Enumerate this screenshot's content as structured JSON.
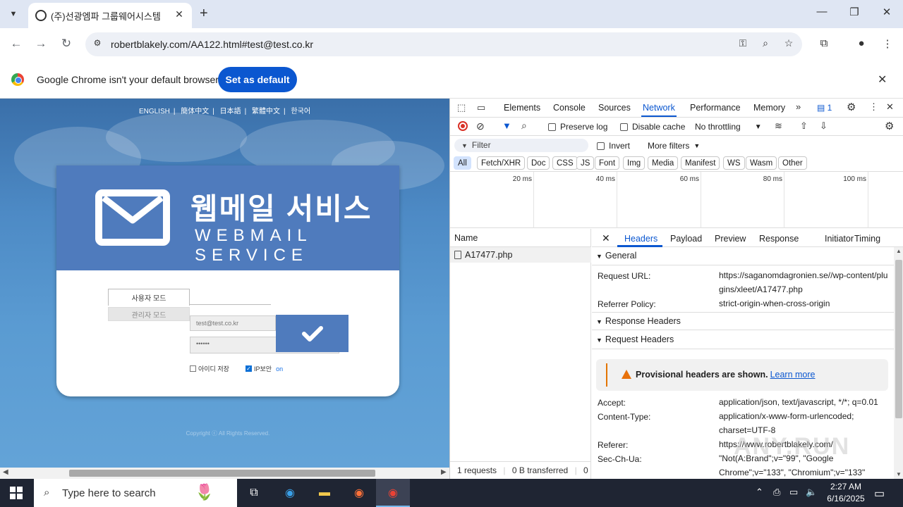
{
  "browser": {
    "tab_title": "(주)선광엠파 그룹웨어시스템",
    "tab_close": "✕",
    "new_tab": "+",
    "url": "robertblakely.com/AA122.html#test@test.co.kr",
    "infobar_message": "Google Chrome isn't your default browser",
    "set_default_label": "Set as default",
    "window_controls": {
      "minimize": "—",
      "restore": "❐",
      "close": "✕"
    }
  },
  "page": {
    "languages": [
      "ENGLISH",
      "簡体中文",
      "日本語",
      "繁體中文",
      "한국어"
    ],
    "title_korean": "웹메일 서비스",
    "title_english": "WEBMAIL SERVICE",
    "user_mode_tab": "사용자 모드",
    "admin_mode_tab": "관리자 모드",
    "email_value": "test@test.co.kr",
    "password_value": "••••••",
    "save_id_label": "아이디 저장",
    "ip_security_label": "IP보안",
    "ip_security_state": "on",
    "copyright": "Copyright ⓒ All Rights Reserved."
  },
  "devtools": {
    "tabs": [
      "Elements",
      "Console",
      "Sources",
      "Network",
      "Performance",
      "Memory"
    ],
    "active_tab": "Network",
    "issues_count": "1",
    "preserve_log": "Preserve log",
    "disable_cache": "Disable cache",
    "throttling": "No throttling",
    "filter_placeholder": "Filter",
    "invert": "Invert",
    "more_filters": "More filters",
    "type_filters": [
      "All",
      "Fetch/XHR",
      "Doc",
      "CSS",
      "JS",
      "Font",
      "Img",
      "Media",
      "Manifest",
      "WS",
      "Wasm",
      "Other"
    ],
    "timeline_ticks": [
      "20 ms",
      "40 ms",
      "60 ms",
      "80 ms",
      "100 ms"
    ],
    "name_header": "Name",
    "request_name": "A17477.php",
    "status_requests": "1 requests",
    "status_transferred": "0 B transferred",
    "status_extra": "0 |",
    "detail_tabs": [
      "Headers",
      "Payload",
      "Preview",
      "Response",
      "Initiator",
      "Timing"
    ],
    "sections": {
      "general": "General",
      "response_headers": "Response Headers",
      "request_headers": "Request Headers"
    },
    "general": {
      "request_url_key": "Request URL:",
      "request_url_val": "https://saganomdagronien.se//wp-content/plugins/xleet/A17477.php",
      "referrer_policy_key": "Referrer Policy:",
      "referrer_policy_val": "strict-origin-when-cross-origin"
    },
    "provisional_text": "Provisional headers are shown.",
    "learn_more": "Learn more",
    "request_headers": {
      "accept_key": "Accept:",
      "accept_val": "application/json, text/javascript, */*; q=0.01",
      "content_type_key": "Content-Type:",
      "content_type_val": "application/x-www-form-urlencoded; charset=UTF-8",
      "referer_key": "Referer:",
      "referer_val": "https://www.robertblakely.com/",
      "sec_ch_ua_key": "Sec-Ch-Ua:",
      "sec_ch_ua_val": "\"Not(A:Brand\";v=\"99\", \"Google Chrome\";v=\"133\", \"Chromium\";v=\"133\""
    }
  },
  "taskbar": {
    "search_placeholder": "Type here to search",
    "time": "2:27 AM",
    "date": "6/16/2025"
  },
  "watermark": "ANY.RUN"
}
